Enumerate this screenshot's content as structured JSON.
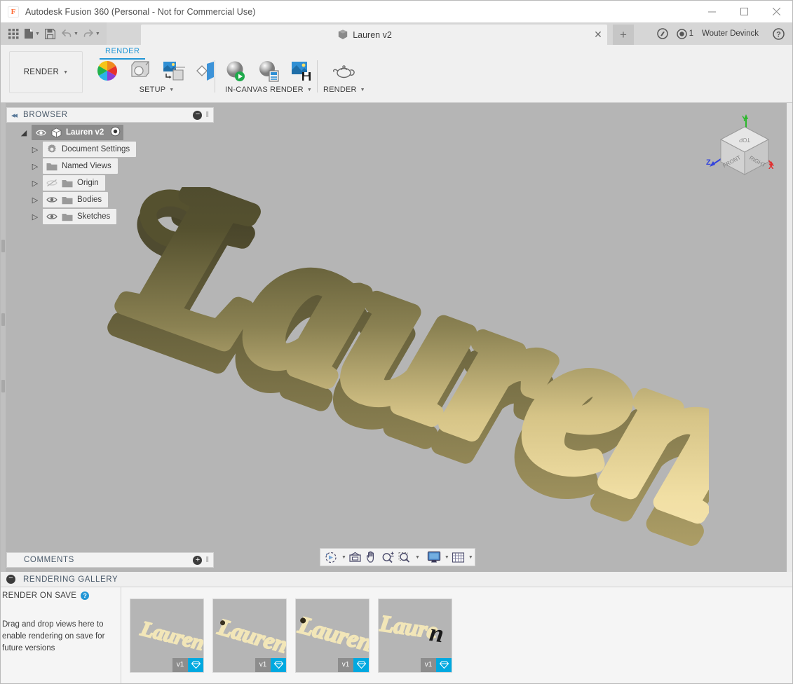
{
  "window": {
    "app_title": "Autodesk Fusion 360 (Personal - Not for Commercial Use)",
    "logo_letter": "F",
    "minimize": "—",
    "maximize": "☐",
    "close": "✕"
  },
  "quick_access": {
    "items": [
      {
        "name": "app-grid-icon",
        "label": ""
      },
      {
        "name": "new-file-icon",
        "label": ""
      },
      {
        "name": "save-icon",
        "label": ""
      },
      {
        "name": "undo-icon",
        "label": ""
      },
      {
        "name": "redo-icon",
        "label": ""
      }
    ]
  },
  "tab": {
    "title": "Lauren v2",
    "close_glyph": "✕",
    "new_tab_glyph": "+"
  },
  "tabstrip_right": {
    "jobs_count": "1",
    "user_name": "Wouter Devinck",
    "help_glyph": "?"
  },
  "ribbon": {
    "workspace_label": "RENDER",
    "workspace_caret": "▾",
    "active_tab": "RENDER",
    "groups": [
      {
        "label": "SETUP",
        "caret": "▾",
        "buttons": [
          {
            "name": "appearance-button",
            "tooltip": "Appearance"
          },
          {
            "name": "scene-settings-button",
            "tooltip": "Scene Settings"
          },
          {
            "name": "decal-button",
            "tooltip": "Decal"
          },
          {
            "name": "texture-map-controls-button",
            "tooltip": "Texture Map Controls"
          }
        ]
      },
      {
        "label": "IN-CANVAS RENDER",
        "caret": "▾",
        "buttons": [
          {
            "name": "in-canvas-render-button",
            "tooltip": "In-Canvas Render"
          },
          {
            "name": "in-canvas-render-settings-button",
            "tooltip": "In-Canvas Render Settings"
          },
          {
            "name": "capture-image-button",
            "tooltip": "Capture Image"
          }
        ]
      },
      {
        "label": "RENDER",
        "caret": "▾",
        "buttons": [
          {
            "name": "render-button",
            "tooltip": "Render"
          }
        ]
      }
    ]
  },
  "browser": {
    "collapse_glyph": "◂◂",
    "title": "BROWSER",
    "minus_glyph": "−",
    "grip_glyph": "‖",
    "tree": [
      {
        "name": "tree-item-root",
        "label": "Lauren v2",
        "icon": "component-icon",
        "eye": true,
        "arrow": "◢",
        "root": true
      },
      {
        "name": "tree-item-document-settings",
        "label": "Document Settings",
        "icon": "gear-icon",
        "eye": false,
        "arrow": "▷",
        "root": false
      },
      {
        "name": "tree-item-named-views",
        "label": "Named Views",
        "icon": "folder-icon",
        "eye": false,
        "arrow": "▷",
        "root": false
      },
      {
        "name": "tree-item-origin",
        "label": "Origin",
        "icon": "folder-icon",
        "eye": "off",
        "arrow": "▷",
        "root": false
      },
      {
        "name": "tree-item-bodies",
        "label": "Bodies",
        "icon": "folder-icon",
        "eye": true,
        "arrow": "▷",
        "root": false
      },
      {
        "name": "tree-item-sketches",
        "label": "Sketches",
        "icon": "folder-icon",
        "eye": true,
        "arrow": "▷",
        "root": false
      }
    ]
  },
  "viewcube": {
    "top": "TOP",
    "front": "FRONT",
    "right": "RIGHT",
    "axis_x": "X",
    "axis_y": "Y",
    "axis_z": "Z",
    "color_x": "#e03030",
    "color_y": "#2cb82c",
    "color_z": "#3344dd"
  },
  "model": {
    "text": "Lauren",
    "color_dark": "#4a472e",
    "color_light": "#f3e0a6",
    "edge_color": "#6e6740",
    "background": "#b5b5b5"
  },
  "navbar": {
    "items": [
      {
        "name": "orbit-icon",
        "caret": true
      },
      {
        "name": "look-at-icon",
        "caret": false
      },
      {
        "name": "pan-icon",
        "caret": false
      },
      {
        "name": "zoom-icon",
        "caret": false
      },
      {
        "name": "zoom-window-icon",
        "caret": true
      },
      {
        "name": "display-settings-icon",
        "caret": true
      },
      {
        "name": "grid-snaps-icon",
        "caret": true
      }
    ]
  },
  "comments": {
    "title": "COMMENTS",
    "plus_glyph": "+",
    "grip_glyph": "‖"
  },
  "gallery": {
    "minus_glyph": "−",
    "title": "RENDERING GALLERY",
    "render_on_save": {
      "title": "RENDER ON SAVE",
      "help_glyph": "?",
      "drop_text": "Drag and drop views here to enable rendering on save for future versions"
    },
    "thumbnails": [
      {
        "name": "gallery-thumb-1",
        "version": "v1",
        "gem": "◈",
        "variant": 1
      },
      {
        "name": "gallery-thumb-2",
        "version": "v1",
        "gem": "◈",
        "variant": 2
      },
      {
        "name": "gallery-thumb-3",
        "version": "v1",
        "gem": "◈",
        "variant": 3
      },
      {
        "name": "gallery-thumb-4",
        "version": "v1",
        "gem": "◈",
        "variant": 4
      }
    ]
  }
}
